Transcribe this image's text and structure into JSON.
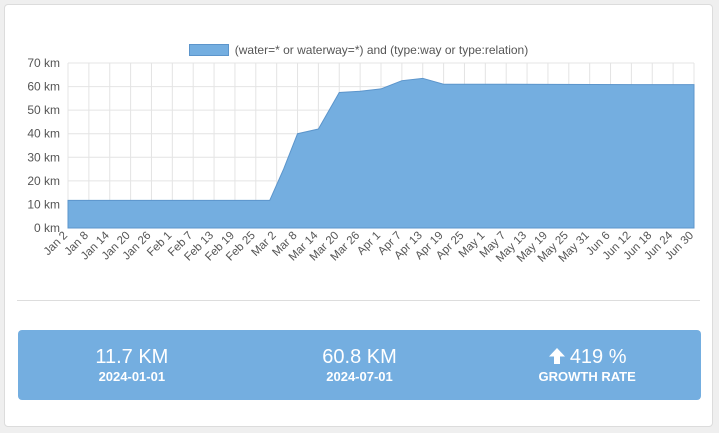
{
  "chart_data": {
    "type": "area",
    "legend": "(water=* or waterway=*) and (type:way or type:relation)",
    "y_ticks": [
      "0 km",
      "10 km",
      "20 km",
      "30 km",
      "40 km",
      "50 km",
      "60 km",
      "70 km"
    ],
    "ylim": [
      0,
      70
    ],
    "x_ticks": [
      "Jan 2",
      "Jan 8",
      "Jan 14",
      "Jan 20",
      "Jan 26",
      "Feb 1",
      "Feb 7",
      "Feb 13",
      "Feb 19",
      "Feb 25",
      "Mar 2",
      "Mar 8",
      "Mar 14",
      "Mar 20",
      "Mar 26",
      "Apr 1",
      "Apr 7",
      "Apr 13",
      "Apr 19",
      "Apr 25",
      "May 1",
      "May 7",
      "May 13",
      "May 19",
      "May 25",
      "May 31",
      "Jun 6",
      "Jun 12",
      "Jun 18",
      "Jun 24",
      "Jun 30"
    ],
    "x_dates": [
      "2024-01-02",
      "2024-01-08",
      "2024-01-14",
      "2024-01-20",
      "2024-01-26",
      "2024-02-01",
      "2024-02-07",
      "2024-02-13",
      "2024-02-19",
      "2024-02-25",
      "2024-03-02",
      "2024-03-08",
      "2024-03-14",
      "2024-03-20",
      "2024-03-26",
      "2024-04-01",
      "2024-04-07",
      "2024-04-13",
      "2024-04-19",
      "2024-04-25",
      "2024-05-01",
      "2024-05-07",
      "2024-05-13",
      "2024-05-19",
      "2024-05-25",
      "2024-05-31",
      "2024-06-06",
      "2024-06-12",
      "2024-06-18",
      "2024-06-24",
      "2024-06-30"
    ],
    "series": [
      {
        "name": "(water=* or waterway=*) and (type:way or type:relation)",
        "color": "#74aee0",
        "points": [
          {
            "x": "2024-01-02",
            "y": 11.7
          },
          {
            "x": "2024-02-29",
            "y": 11.7
          },
          {
            "x": "2024-03-04",
            "y": 25
          },
          {
            "x": "2024-03-08",
            "y": 40
          },
          {
            "x": "2024-03-14",
            "y": 42
          },
          {
            "x": "2024-03-20",
            "y": 57.5
          },
          {
            "x": "2024-03-26",
            "y": 58
          },
          {
            "x": "2024-04-01",
            "y": 59
          },
          {
            "x": "2024-04-07",
            "y": 62.5
          },
          {
            "x": "2024-04-13",
            "y": 63.5
          },
          {
            "x": "2024-04-19",
            "y": 61
          },
          {
            "x": "2024-04-25",
            "y": 61
          },
          {
            "x": "2024-06-30",
            "y": 60.8
          }
        ]
      }
    ],
    "grid": true
  },
  "stats": {
    "start_value": "11.7 KM",
    "start_label": "2024-01-01",
    "end_value": "60.8 KM",
    "end_label": "2024-07-01",
    "growth_value": "419 %",
    "growth_label": "GROWTH RATE"
  }
}
